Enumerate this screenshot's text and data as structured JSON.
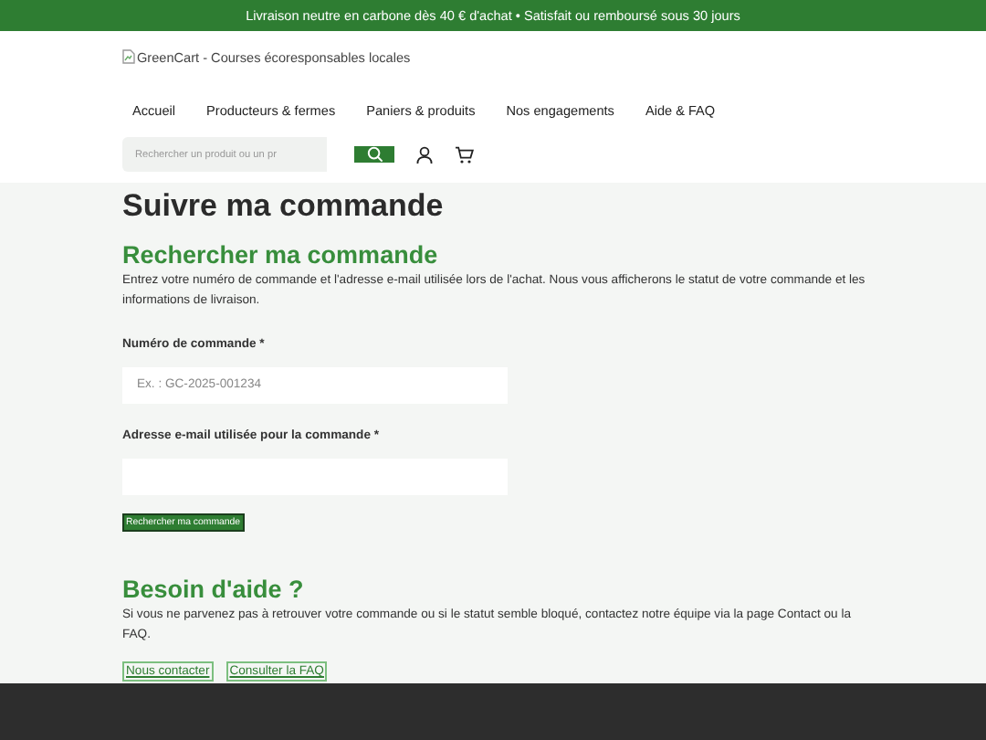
{
  "banner": {
    "text": "Livraison neutre en carbone dès 40 € d'achat • Satisfait ou remboursé sous 30 jours"
  },
  "header": {
    "logo_alt": "GreenCart - Courses écoresponsables locales",
    "nav": [
      {
        "label": "Accueil"
      },
      {
        "label": "Producteurs & fermes"
      },
      {
        "label": "Paniers & produits"
      },
      {
        "label": "Nos engagements"
      },
      {
        "label": "Aide & FAQ"
      }
    ],
    "search": {
      "placeholder": "Rechercher un produit ou un pr"
    }
  },
  "page_title": "Suivre ma commande",
  "lookup": {
    "heading": "Rechercher ma commande",
    "intro": "Entrez votre numéro de commande et l'adresse e-mail utilisée lors de l'achat. Nous vous afficherons le statut de votre commande et les informations de livraison.",
    "fields": [
      {
        "label": "Numéro de commande *",
        "placeholder": "Ex. : GC-2025-001234"
      },
      {
        "label": "Adresse e-mail utilisée pour la commande *"
      }
    ],
    "submit": "Rechercher ma commande"
  },
  "help": {
    "heading": "Besoin d'aide ?",
    "text": "Si vous ne parvenez pas à retrouver votre commande ou si le statut semble bloqué, contactez notre équipe via la page Contact ou la FAQ.",
    "links": [
      "Nous contacter",
      "Consulter la FAQ"
    ]
  }
}
